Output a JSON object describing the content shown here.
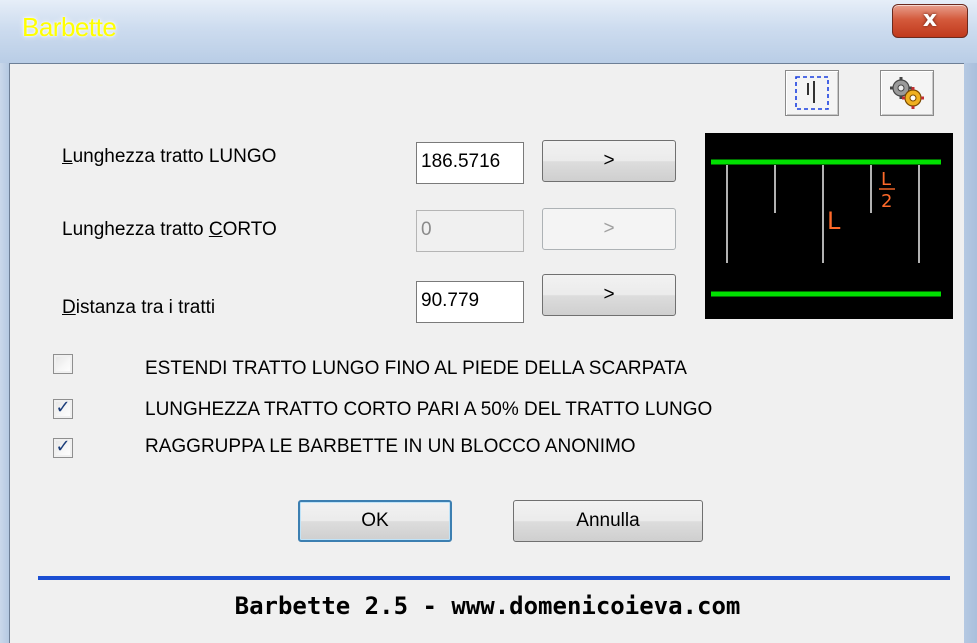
{
  "window": {
    "title": "Barbette",
    "close_label": "x"
  },
  "toolbar": {
    "select_icon": "dashed-select-icon",
    "settings_icon": "gears-icon"
  },
  "fields": [
    {
      "label_ul": "L",
      "label_rest": "unghezza tratto LUNGO",
      "value": "186.5716",
      "button": ">",
      "enabled": true
    },
    {
      "label_pre": "Lunghezza tratto ",
      "label_ul": "C",
      "label_rest": "ORTO",
      "value": "0",
      "button": ">",
      "enabled": false
    },
    {
      "label_ul": "D",
      "label_rest": "istanza tra i tratti",
      "value": "90.779",
      "button": ">",
      "enabled": true
    }
  ],
  "preview": {
    "label_L": "L",
    "label_half_num": "L",
    "label_half_den": "2"
  },
  "options": [
    {
      "label": "ESTENDI TRATTO LUNGO FINO AL PIEDE DELLA SCARPATA",
      "checked": false
    },
    {
      "label": "LUNGHEZZA TRATTO CORTO PARI A 50% DEL TRATTO LUNGO",
      "checked": true
    },
    {
      "label": "RAGGRUPPA LE BARBETTE IN UN BLOCCO ANONIMO",
      "checked": true
    }
  ],
  "buttons": {
    "ok": "OK",
    "cancel": "Annulla"
  },
  "footer": "Barbette 2.5 - www.domenicoieva.com",
  "colors": {
    "title_text": "#ffff00",
    "preview_bg": "#000000",
    "preview_green": "#00e000",
    "preview_label": "#ff6a2a",
    "footer_line": "#1b4ed3"
  }
}
